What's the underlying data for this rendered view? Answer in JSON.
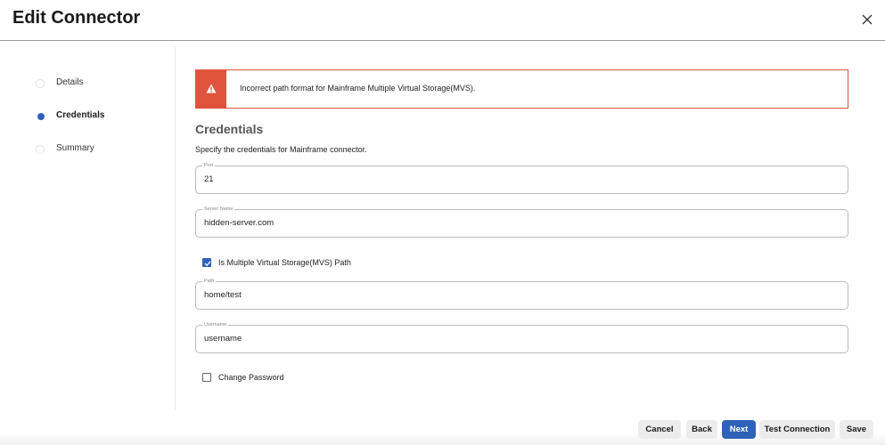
{
  "header": {
    "title": "Edit Connector"
  },
  "stepper": {
    "steps": [
      {
        "label": "Details",
        "active": false
      },
      {
        "label": "Credentials",
        "active": true
      },
      {
        "label": "Summary",
        "active": false
      }
    ]
  },
  "error": {
    "message": "Incorrect path format for Mainframe Multiple Virtual Storage(MVS)."
  },
  "section": {
    "title": "Credentials",
    "description": "Specify the credentials for Mainframe connector."
  },
  "fields": {
    "port": {
      "label": "Port",
      "value": "21"
    },
    "server_name": {
      "label": "Server Name",
      "value": "hidden-server.com"
    },
    "path": {
      "label": "Path",
      "value": "home/test"
    },
    "username": {
      "label": "Username",
      "value": "username"
    }
  },
  "checkboxes": {
    "mvs_path": {
      "label": "Is Multiple Virtual Storage(MVS) Path",
      "checked": true
    },
    "change_password": {
      "label": "Change Password",
      "checked": false
    }
  },
  "footer": {
    "cancel": "Cancel",
    "back": "Back",
    "next": "Next",
    "test_connection": "Test Connection",
    "save": "Save"
  },
  "colors": {
    "accent": "#2e62b8",
    "error": "#e0533c"
  },
  "icons": {
    "close": "close-icon",
    "warning": "warning-icon",
    "check": "check-icon"
  }
}
